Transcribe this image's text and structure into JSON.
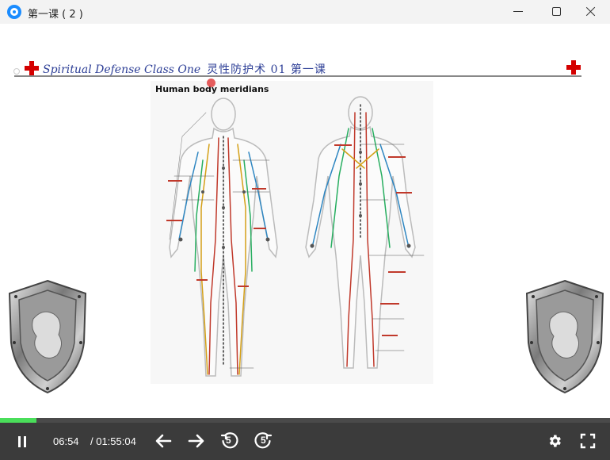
{
  "window": {
    "title": "第一课 ( 2 )",
    "icon": "app-logo-icon"
  },
  "slide": {
    "header_en": "Spiritual Defense Class One",
    "header_cn": "灵性防护术 01 第一课",
    "panel_title": "Human body meridians",
    "accent_color": "#d40000",
    "header_color": "#2c3e96"
  },
  "player": {
    "current_time": "06:54",
    "total_time": "/ 01:55:04",
    "progress_fraction": 0.06,
    "progress_color": "#4ade5a",
    "buttons": {
      "pause": "pause-icon",
      "prev": "arrow-left-icon",
      "next": "arrow-right-icon",
      "rewind": "rewind-5-icon",
      "forward": "forward-5-icon",
      "settings": "gear-icon",
      "fullscreen": "fullscreen-icon"
    },
    "rewind_label": "5",
    "forward_label": "5"
  }
}
